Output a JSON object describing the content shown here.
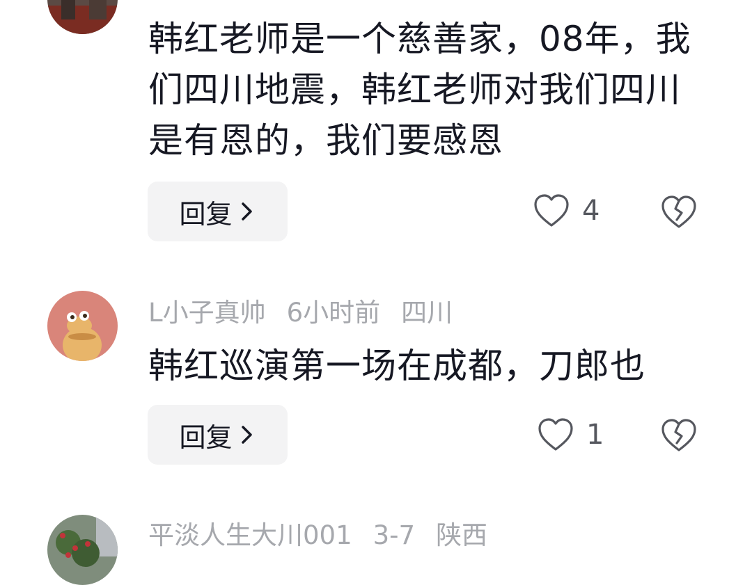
{
  "comments": [
    {
      "text": "韩红老师是一个慈善家，08年，我们四川地震，韩红老师对我们四川是有恩的，我们要感恩",
      "reply_label": "回复",
      "like_count": "4",
      "avatar_icon": "landscape-photo-avatar"
    },
    {
      "username": "L小子真帅",
      "time": "6小时前",
      "location": "四川",
      "text": "韩红巡演第一场在成都，刀郎也",
      "reply_label": "回复",
      "like_count": "1",
      "avatar_icon": "cartoon-character-avatar"
    },
    {
      "username": "平淡人生大川001",
      "time": "3-7",
      "location": "陕西",
      "avatar_icon": "flower-tree-avatar"
    }
  ],
  "colors": {
    "text": "#161823",
    "meta": "#a6a8ad",
    "reply_bg": "#f3f3f4",
    "icon": "#55575e"
  }
}
